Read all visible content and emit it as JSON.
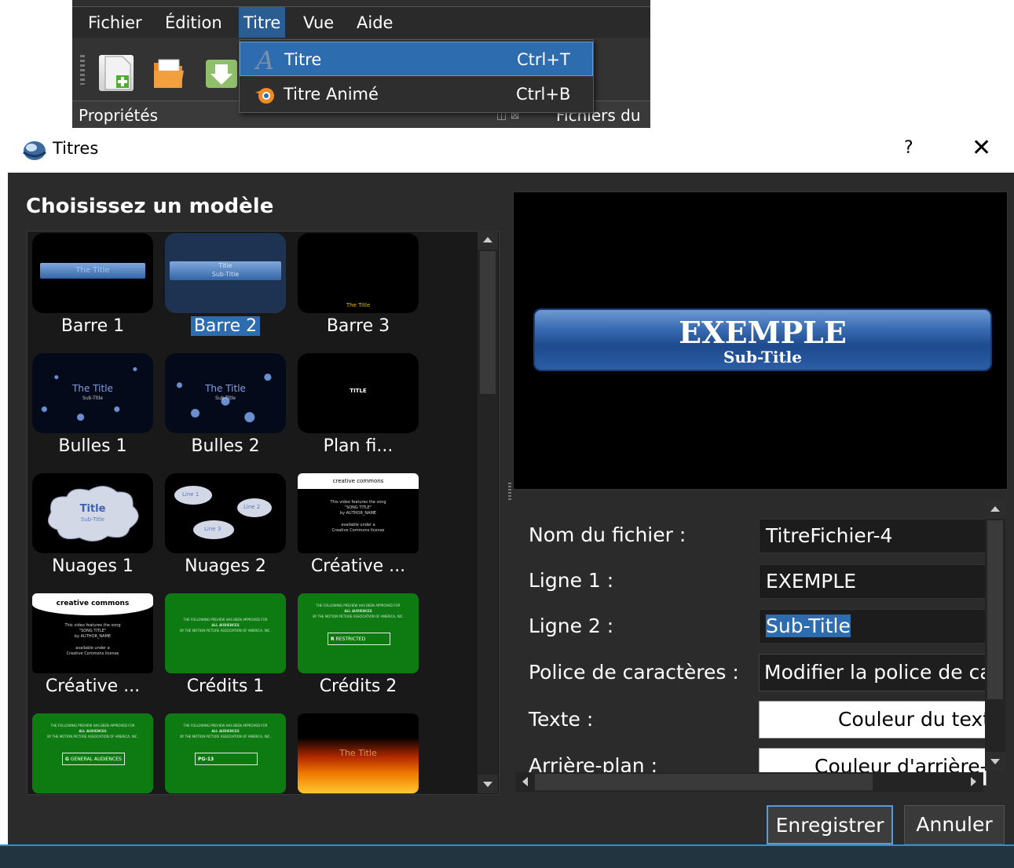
{
  "menubar": {
    "items": [
      "Fichier",
      "Édition",
      "Titre",
      "Vue",
      "Aide"
    ]
  },
  "titre_menu": {
    "items": [
      {
        "label": "Titre",
        "shortcut": "Ctrl+T"
      },
      {
        "label": "Titre Animé",
        "shortcut": "Ctrl+B"
      }
    ]
  },
  "main_panels": {
    "properties_label": "Propriétés",
    "files_label": "Fichiers du"
  },
  "dialog": {
    "title": "Titres",
    "help": "?",
    "close": "✕",
    "heading": "Choisissez un modèle",
    "templates": [
      {
        "label": "Barre 1"
      },
      {
        "label": "Barre 2"
      },
      {
        "label": "Barre 3"
      },
      {
        "label": "Bulles 1"
      },
      {
        "label": "Bulles 2"
      },
      {
        "label": "Plan fi..."
      },
      {
        "label": "Nuages 1"
      },
      {
        "label": "Nuages 2"
      },
      {
        "label": "Créative ..."
      },
      {
        "label": "Créative ..."
      },
      {
        "label": "Crédits 1"
      },
      {
        "label": "Crédits 2"
      },
      {
        "label": ""
      },
      {
        "label": ""
      },
      {
        "label": ""
      }
    ],
    "selected_template": "Barre 2",
    "thumb_text": {
      "the_title": "The Title",
      "title": "Title",
      "sub_title": "Sub-Title",
      "title_caps": "TITLE",
      "line1": "Line 1",
      "line2": "Line 2",
      "line3": "Line 3",
      "cc_name": "creative commons",
      "cc_line1": "This video features the song",
      "cc_song": "\"SONG TITLE\"",
      "cc_author": "by AUTHOR_NAME",
      "cc_available": "available under a",
      "cc_license": "Creative Commons license",
      "rating_header": "THE FOLLOWING PREVIEW HAS BEEN APPROVED FOR",
      "rating_audience": "ALL AUDIENCES",
      "rating_org": "BY THE MOTION PICTURE ASSOCIATION OF AMERICA, INC.",
      "rating_r": "R",
      "rating_g": "G",
      "rating_pg13": "PG-13",
      "rating_r_text": "RESTRICTED",
      "rating_g_text": "GENERAL AUDIENCES"
    },
    "preview": {
      "line1": "EXEMPLE",
      "line2": "Sub-Title"
    },
    "form": {
      "filename_label": "Nom du fichier :",
      "filename_value": "TitreFichier-4",
      "line1_label": "Ligne 1 :",
      "line1_value": "EXEMPLE",
      "line2_label": "Ligne 2 :",
      "line2_value": "Sub-Title",
      "font_label": "Police de caractères :",
      "font_button": "Modifier la police de caractères",
      "text_label": "Texte :",
      "text_button": "Couleur du texte",
      "bg_label": "Arrière-plan :",
      "bg_button": "Couleur d'arrière-plan"
    },
    "buttons": {
      "save": "Enregistrer",
      "cancel": "Annuler"
    }
  }
}
